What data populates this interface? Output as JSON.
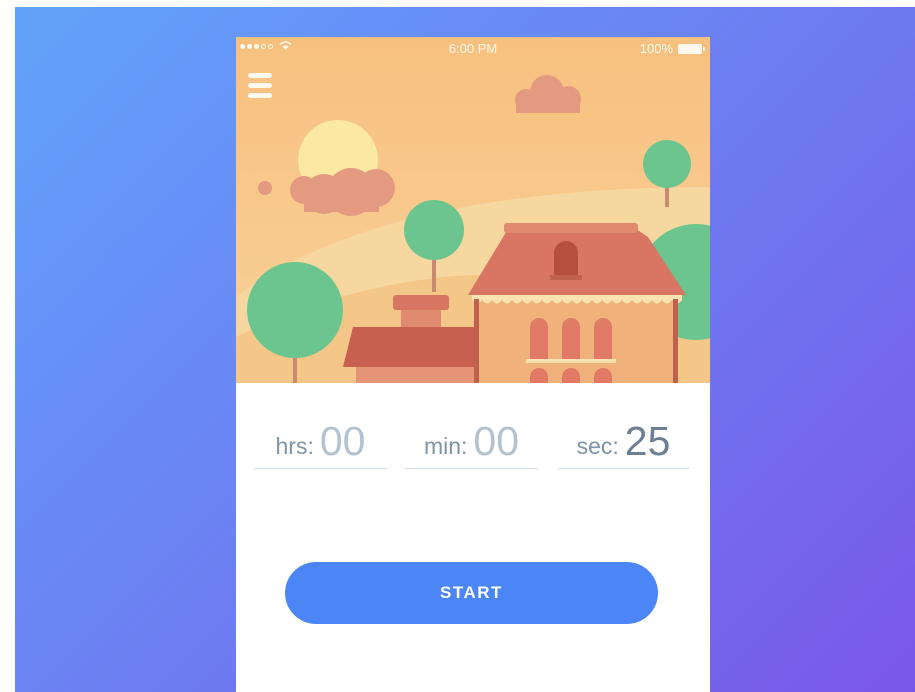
{
  "status_bar": {
    "time": "6:00 PM",
    "battery": "100%"
  },
  "timer": {
    "hours": {
      "label": "hrs:",
      "value": "00"
    },
    "minutes": {
      "label": "min:",
      "value": "00"
    },
    "seconds": {
      "label": "sec:",
      "value": "25"
    }
  },
  "start_button": {
    "label": "START"
  },
  "colors": {
    "accent": "#4c86f6",
    "background_gradient_start": "#62a3fb",
    "background_gradient_end": "#7a57e8",
    "scene_sky": "#f8c78a",
    "house": "#f0b27a",
    "roof": "#d97563",
    "tree": "#6cc58e"
  }
}
